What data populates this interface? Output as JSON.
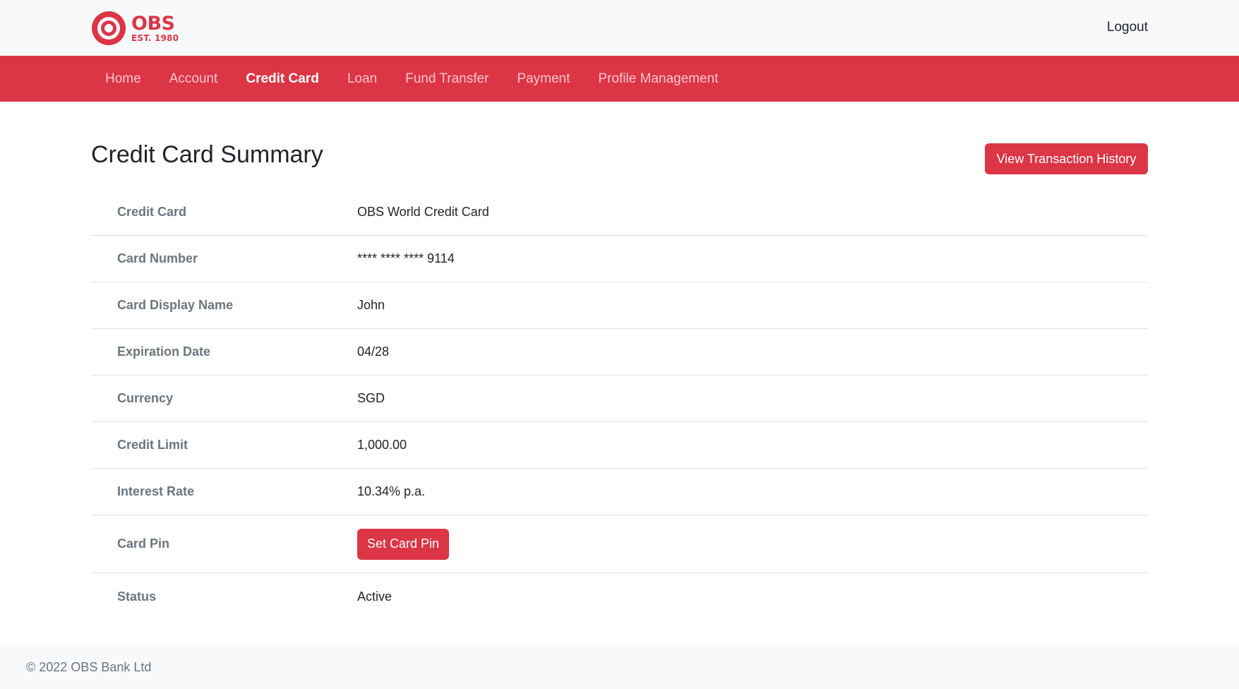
{
  "header": {
    "logo_name": "OBS",
    "logo_est": "EST. 1980",
    "logout_label": "Logout"
  },
  "nav": {
    "items": [
      {
        "label": "Home"
      },
      {
        "label": "Account"
      },
      {
        "label": "Credit Card"
      },
      {
        "label": "Loan"
      },
      {
        "label": "Fund Transfer"
      },
      {
        "label": "Payment"
      },
      {
        "label": "Profile Management"
      }
    ],
    "active_item": "Credit Card"
  },
  "main": {
    "title": "Credit Card Summary",
    "history_button_label": "View Transaction History",
    "details": [
      {
        "label": "Credit Card",
        "value": "OBS World Credit Card"
      },
      {
        "label": "Card Number",
        "value": "**** **** **** 9114"
      },
      {
        "label": "Card Display Name",
        "value": "John"
      },
      {
        "label": "Expiration Date",
        "value": "04/28"
      },
      {
        "label": "Currency",
        "value": "SGD"
      },
      {
        "label": "Credit Limit",
        "value": "1,000.00"
      },
      {
        "label": "Interest Rate",
        "value": "10.34% p.a."
      },
      {
        "label": "Card Pin",
        "button_label": "Set Card Pin"
      },
      {
        "label": "Status",
        "value": "Active"
      }
    ]
  },
  "footer": {
    "copyright": "© 2022 OBS Bank Ltd"
  },
  "colors": {
    "brand_red": "#dc3545",
    "topbar_bg": "#f8f9fa",
    "label_gray": "#6c757d"
  }
}
